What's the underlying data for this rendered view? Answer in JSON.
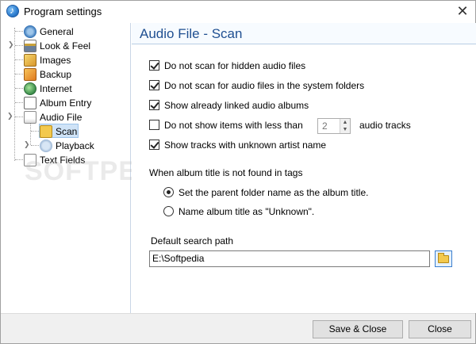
{
  "window": {
    "title": "Program settings",
    "close_glyph": "✕"
  },
  "tree": {
    "items": [
      {
        "label": "General",
        "icon": "gear-icon"
      },
      {
        "label": "Look & Feel",
        "icon": "palette-icon"
      },
      {
        "label": "Images",
        "icon": "images-icon"
      },
      {
        "label": "Backup",
        "icon": "backup-icon"
      },
      {
        "label": "Internet",
        "icon": "globe-icon"
      },
      {
        "label": "Album Entry",
        "icon": "album-icon"
      },
      {
        "label": "Audio File",
        "icon": "audio-file-icon"
      },
      {
        "label": "Scan",
        "icon": "folder-scan-icon"
      },
      {
        "label": "Playback",
        "icon": "play-icon"
      },
      {
        "label": "Text Fields",
        "icon": "text-fields-icon"
      }
    ],
    "selected": "Scan"
  },
  "page": {
    "title": "Audio File - Scan"
  },
  "options": {
    "hidden_files": {
      "label": "Do not scan for hidden audio files",
      "checked": true
    },
    "system_folders": {
      "label": "Do not scan for audio files in the system folders",
      "checked": true
    },
    "linked_albums": {
      "label": "Show already linked audio albums",
      "checked": true
    },
    "less_than": {
      "label": "Do not show items with less than",
      "checked": false,
      "value": "2",
      "suffix": "audio tracks"
    },
    "unknown_artist": {
      "label": "Show tracks with unknown artist name",
      "checked": true
    }
  },
  "album_title": {
    "label": "When album title is not found in tags",
    "options": [
      {
        "label": "Set the parent folder name as the album title.",
        "checked": true
      },
      {
        "label": "Name album title as \"Unknown\".",
        "checked": false
      }
    ]
  },
  "search_path": {
    "label": "Default search path",
    "value": "E:\\Softpedia"
  },
  "buttons": {
    "save_close": "Save & Close",
    "close": "Close"
  },
  "watermark": "SOFTPEDIA",
  "colors": {
    "title_blue": "#1f4f91",
    "selection": "#cfe3f7"
  }
}
